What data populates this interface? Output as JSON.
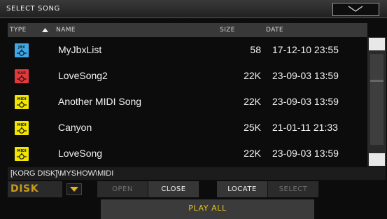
{
  "title": "SELECT SONG",
  "columns": {
    "type": "TYPE",
    "name": "NAME",
    "size": "SIZE",
    "date": "DATE"
  },
  "files": [
    {
      "type": "JBX",
      "name": "MyJbxList",
      "size": "58",
      "date": "17-12-10 23:55"
    },
    {
      "type": "KAR",
      "name": "LoveSong2",
      "size": "22K",
      "date": "23-09-03 13:59"
    },
    {
      "type": "MIDI",
      "name": "Another MIDI Song",
      "size": "22K",
      "date": "23-09-03 13:59"
    },
    {
      "type": "MIDI",
      "name": "Canyon",
      "size": "25K",
      "date": "21-01-11 21:33"
    },
    {
      "type": "MIDI",
      "name": "LoveSong",
      "size": "22K",
      "date": "23-09-03 13:59"
    }
  ],
  "current_path": "[KORG DISK]\\MYSHOW\\MIDI",
  "device": "DISK",
  "buttons": {
    "open": "OPEN",
    "close": "CLOSE",
    "locate": "LOCATE",
    "select": "SELECT"
  },
  "play_all": "PLAY ALL",
  "colors": {
    "jbx": "#3fa8e6",
    "kar": "#e23a3a",
    "midi": "#f2e600",
    "accent": "#c99a1c"
  }
}
